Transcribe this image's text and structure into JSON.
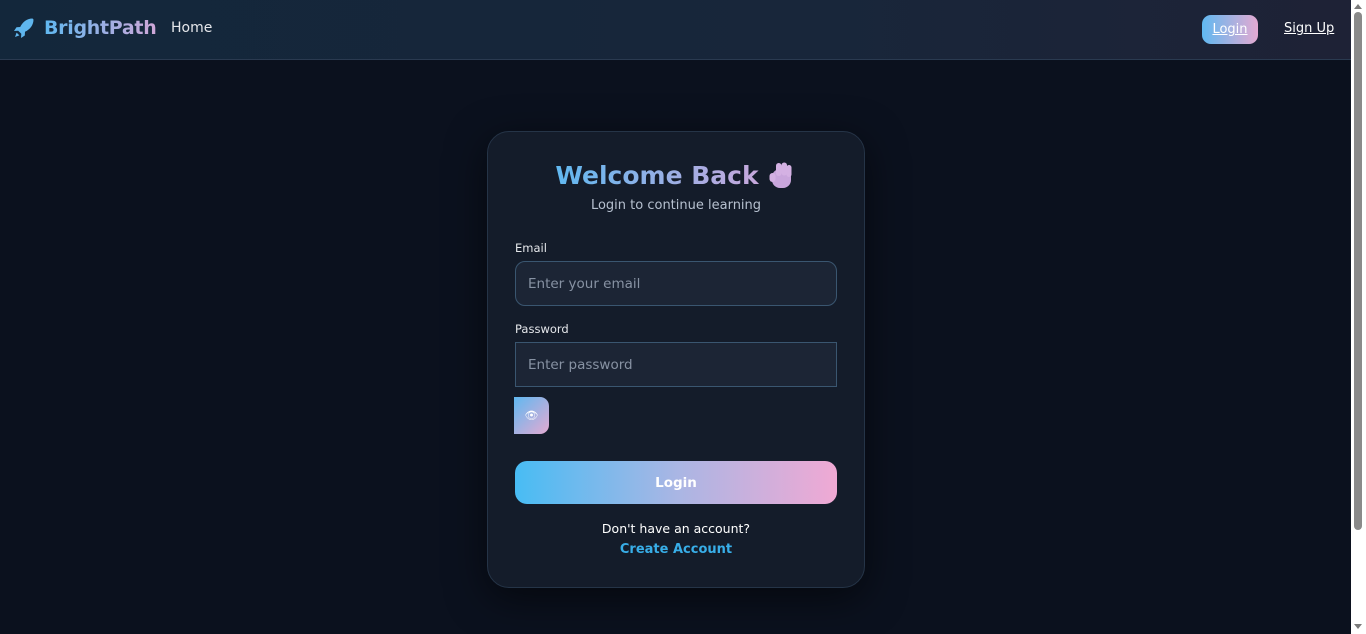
{
  "navbar": {
    "brand": "BrightPath",
    "brand_icon": "rocket-icon",
    "links": {
      "home": "Home",
      "login": "Login",
      "signup": "Sign Up"
    }
  },
  "card": {
    "title": "Welcome Back",
    "title_icon": "waving-hand-icon",
    "subtitle": "Login to continue learning",
    "email": {
      "label": "Email",
      "placeholder": "Enter your email",
      "value": ""
    },
    "password": {
      "label": "Password",
      "placeholder": "Enter password",
      "value": ""
    },
    "toggle_icon": "eye-icon",
    "login_label": "Login",
    "signup_prompt": "Don't have an account?",
    "create_account": "Create Account"
  },
  "colors": {
    "background": "#0b111e",
    "card": "#141c2a",
    "accent_blue": "#48bcf4",
    "accent_pink": "#f0a9d4",
    "link": "#38aee8"
  }
}
